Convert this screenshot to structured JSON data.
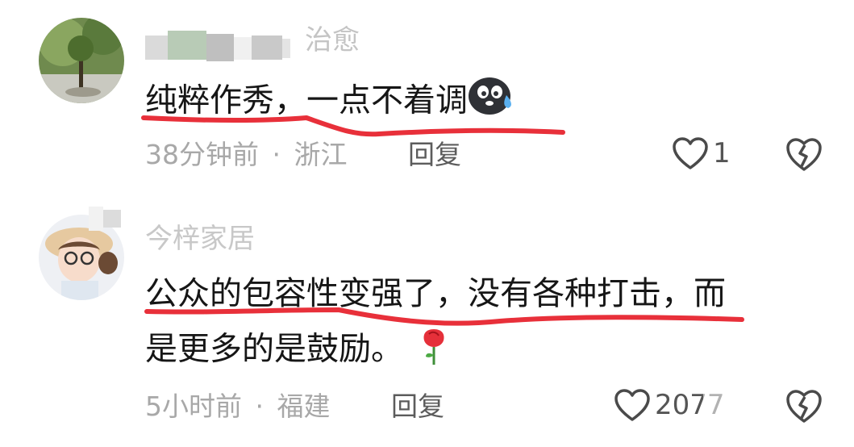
{
  "comments": [
    {
      "username_visible": "治愈",
      "text": "纯粹作秀，一点不着调",
      "time": "38分钟前",
      "separator": "·",
      "location": "浙江",
      "reply_label": "回复",
      "like_count": "1",
      "emoji": "sweat-face-emoji"
    },
    {
      "username_visible": "今梓家居",
      "text_line1": "公众的包容性变强了，没有各种打击，而",
      "text_line2": "是更多的是鼓励。",
      "time": "5小时前",
      "separator": "·",
      "location": "福建",
      "reply_label": "回复",
      "like_count": "2077",
      "emoji": "rose-emoji"
    }
  ],
  "colors": {
    "underline": "#e8303a",
    "meta_gray": "#a8a8a8",
    "username_gray": "#c4c4c4"
  }
}
